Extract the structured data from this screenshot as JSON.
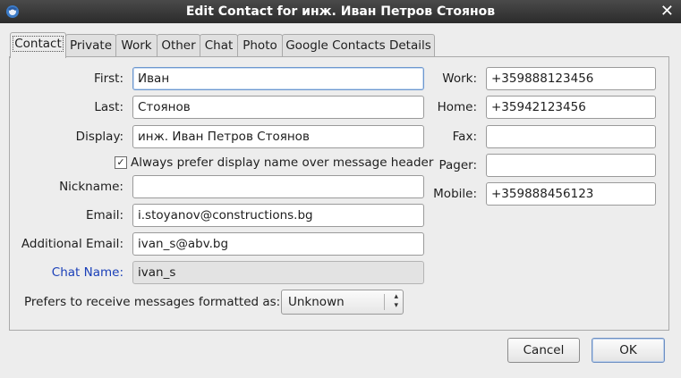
{
  "window": {
    "title": "Edit Contact for инж. Иван Петров Стоянов"
  },
  "tabs": [
    {
      "label": "Contact",
      "active": true
    },
    {
      "label": "Private"
    },
    {
      "label": "Work"
    },
    {
      "label": "Other"
    },
    {
      "label": "Chat"
    },
    {
      "label": "Photo"
    },
    {
      "label": "Google Contacts Details"
    }
  ],
  "contact": {
    "first": {
      "label": "First:",
      "value": "Иван"
    },
    "last": {
      "label": "Last:",
      "value": "Стоянов"
    },
    "display": {
      "label": "Display:",
      "value": "инж. Иван Петров Стоянов"
    },
    "prefer_display": {
      "label": "Always prefer display name over message header",
      "checked": true
    },
    "nickname": {
      "label": "Nickname:",
      "value": ""
    },
    "email": {
      "label": "Email:",
      "value": "i.stoyanov@constructions.bg"
    },
    "additional_email": {
      "label": "Additional Email:",
      "value": "ivan_s@abv.bg"
    },
    "chat_name": {
      "label": "Chat Name:",
      "value": "ivan_s"
    },
    "format": {
      "label": "Prefers to receive messages formatted as:",
      "value": "Unknown"
    }
  },
  "phones": {
    "work": {
      "label": "Work:",
      "value": "+359888123456"
    },
    "home": {
      "label": "Home:",
      "value": "+35942123456"
    },
    "fax": {
      "label": "Fax:",
      "value": ""
    },
    "pager": {
      "label": "Pager:",
      "value": ""
    },
    "mobile": {
      "label": "Mobile:",
      "value": "+359888456123"
    }
  },
  "buttons": {
    "cancel": "Cancel",
    "ok": "OK"
  },
  "colors": {
    "titlebar": "#2b2b2b",
    "chat_label": "#1a3fb8",
    "focus_border": "#6d97cf"
  }
}
